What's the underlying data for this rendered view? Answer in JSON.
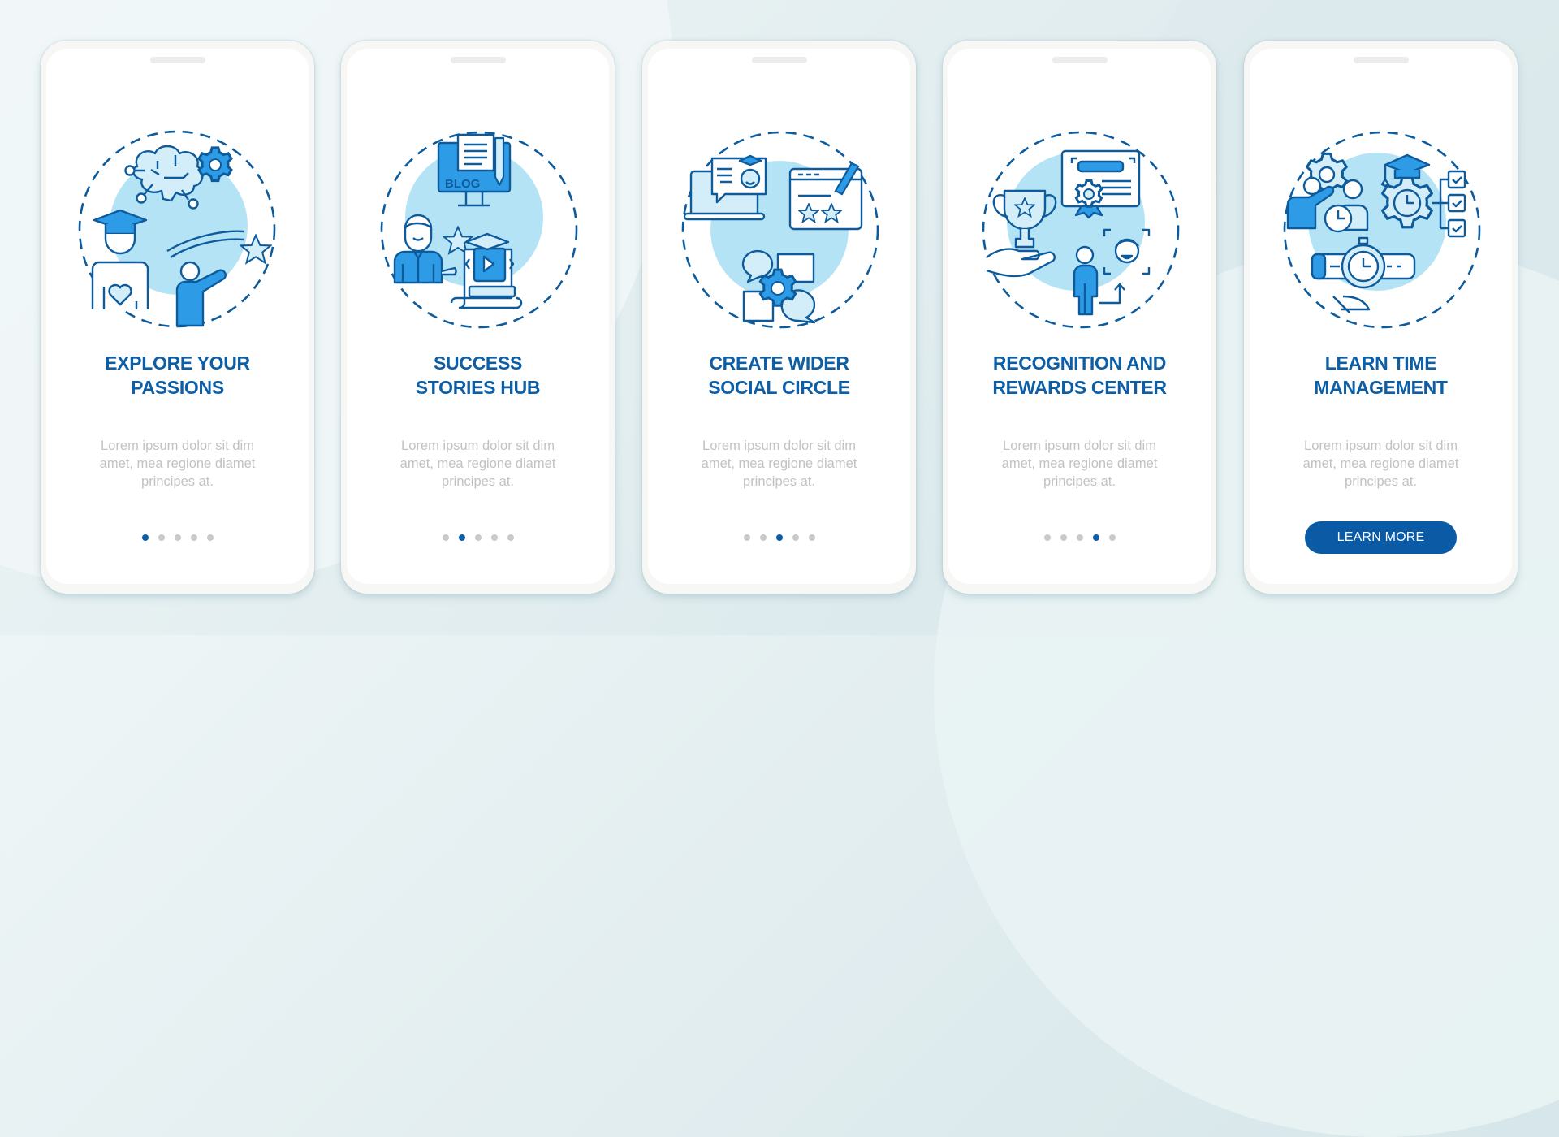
{
  "colors": {
    "title": "#0c5ea6",
    "body_text": "#c2c2c2",
    "dot_active": "#0c5ea6",
    "dot_inactive": "#c9c9c9",
    "button_bg": "#0b5aa6",
    "icon_stroke": "#0e5b9c",
    "icon_fill": "#2e9be6",
    "icon_light": "#d3edf9",
    "illustration_circle": "#b5e3f6"
  },
  "screens": [
    {
      "title_lines": [
        "EXPLORE YOUR",
        "PASSIONS"
      ],
      "body_lines": [
        "Lorem ipsum dolor sit dim",
        "amet, mea regione diamet",
        "principes at."
      ],
      "illustration": [
        "brain-icon",
        "gear-icon",
        "graduate-icon",
        "heart-icon",
        "person-pointing-icon",
        "star-icon"
      ],
      "page_index": 1,
      "page_count": 5
    },
    {
      "title_lines": [
        "SUCCESS",
        "STORIES HUB"
      ],
      "body_lines": [
        "Lorem ipsum dolor sit dim",
        "amet, mea regione diamet",
        "principes at."
      ],
      "illustration": [
        "blog-monitor-icon",
        "pencil-icon",
        "businessman-icon",
        "star-icon",
        "video-course-icon"
      ],
      "blog_label": "BLOG",
      "page_index": 2,
      "page_count": 5
    },
    {
      "title_lines": [
        "CREATE WIDER",
        "SOCIAL CIRCLE"
      ],
      "body_lines": [
        "Lorem ipsum dolor sit dim",
        "amet, mea regione diamet",
        "principes at."
      ],
      "illustration": [
        "laptop-chat-icon",
        "review-window-icon",
        "chat-bubbles-icon",
        "gear-icon"
      ],
      "page_index": 3,
      "page_count": 5
    },
    {
      "title_lines": [
        "RECOGNITION AND",
        "REWARDS CENTER"
      ],
      "body_lines": [
        "Lorem ipsum dolor sit dim",
        "amet, mea regione diamet",
        "principes at."
      ],
      "illustration": [
        "trophy-hand-icon",
        "certificate-icon",
        "person-icon",
        "face-focus-icon"
      ],
      "page_index": 4,
      "page_count": 5
    },
    {
      "title_lines": [
        "LEARN TIME",
        "MANAGEMENT"
      ],
      "body_lines": [
        "Lorem ipsum dolor sit dim",
        "amet, mea regione diamet",
        "principes at."
      ],
      "illustration": [
        "team-gear-icon",
        "clock-icon",
        "graduation-gear-icon",
        "checklist-icon",
        "watch-hand-icon"
      ],
      "button_label": "LEARN MORE"
    }
  ]
}
